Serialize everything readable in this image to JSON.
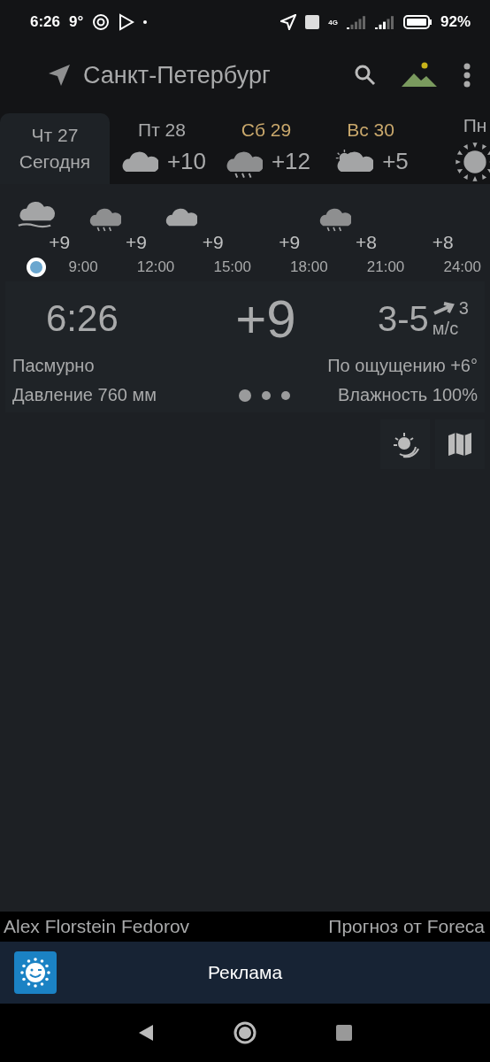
{
  "status_bar": {
    "time": "6:26",
    "temperature": "9°",
    "network": "4G",
    "battery": "92%"
  },
  "app_bar": {
    "city": "Санкт-Петербург"
  },
  "days": [
    {
      "day": "Чт 27",
      "subtitle": "Сегодня",
      "selected": true,
      "weekend": false
    },
    {
      "day": "Пт 28",
      "temp": "+10",
      "kind": "cloud",
      "selected": false,
      "weekend": false
    },
    {
      "day": "Сб 29",
      "temp": "+12",
      "kind": "rain",
      "selected": false,
      "weekend": true
    },
    {
      "day": "Вс 30",
      "temp": "+5",
      "kind": "partly",
      "selected": false,
      "weekend": true
    },
    {
      "day": "Пн",
      "kind": "sun",
      "selected": false,
      "weekend": false
    }
  ],
  "hours": [
    {
      "kind": "fog",
      "temp": "+9",
      "time": "9:00",
      "now": true
    },
    {
      "kind": "rain",
      "temp": "+9",
      "time": "12:00",
      "now": false
    },
    {
      "kind": "cloud",
      "temp": "+9",
      "time": "15:00",
      "now": false
    },
    {
      "temp": "+9",
      "time": "18:00",
      "now": false
    },
    {
      "kind": "rain",
      "temp": "+8",
      "time": "21:00",
      "now": false
    },
    {
      "temp": "+8",
      "time": "24:00",
      "now": false
    }
  ],
  "current": {
    "time": "6:26",
    "temp": "+9",
    "wind": "3-5",
    "wind_gust": "3",
    "wind_unit": "м/с",
    "condition": "Пасмурно",
    "feels_like": "По ощущению +6°",
    "pressure": "Давление 760 мм",
    "humidity": "Влажность 100%",
    "pages": [
      {
        "selected": true
      },
      {
        "selected": false
      },
      {
        "selected": false
      }
    ]
  },
  "footer": {
    "author": "Alex Florstein Fedorov",
    "source": "Прогноз от Foreca"
  },
  "ad": {
    "label": "Реклама"
  }
}
